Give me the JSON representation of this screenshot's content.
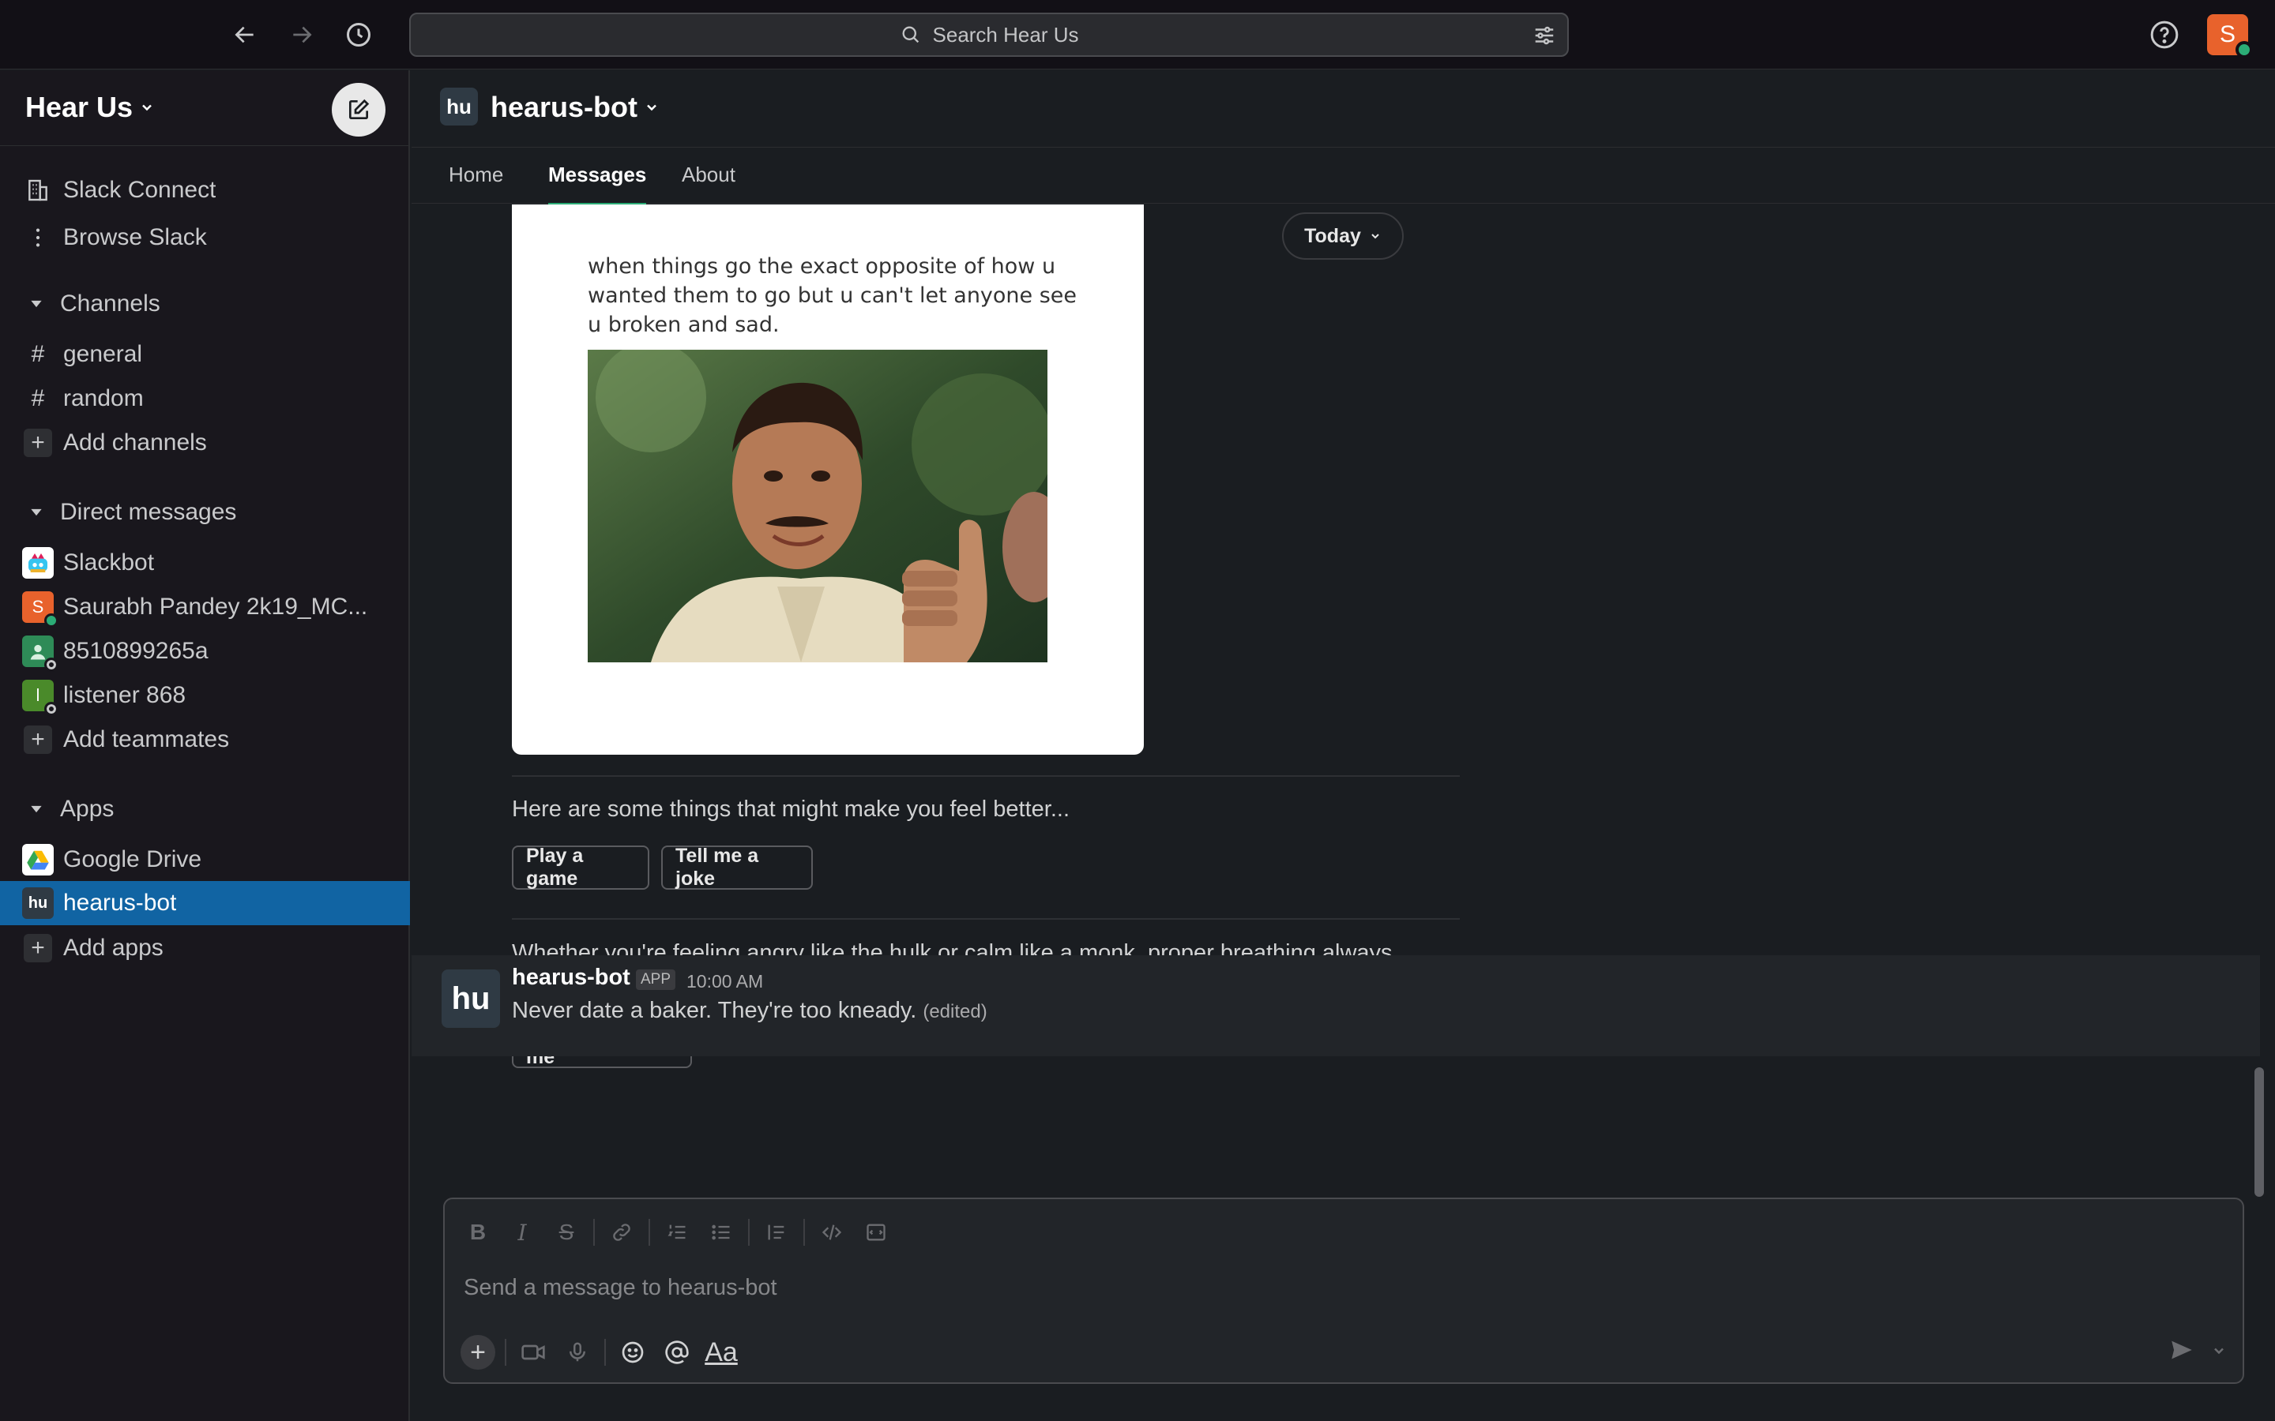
{
  "topbar": {
    "search_placeholder": "Search Hear Us",
    "user_initial": "S"
  },
  "sidebar": {
    "workspace_name": "Hear Us",
    "top_items": [
      {
        "label": "Slack Connect"
      },
      {
        "label": "Browse Slack"
      }
    ],
    "channels_header": "Channels",
    "channels": [
      {
        "label": "general"
      },
      {
        "label": "random"
      }
    ],
    "add_channels": "Add channels",
    "dms_header": "Direct messages",
    "dms": [
      {
        "label": "Slackbot",
        "initial": ""
      },
      {
        "label": "Saurabh Pandey 2k19_MC...",
        "initial": "S",
        "color": "#e8622c"
      },
      {
        "label": "8510899265a",
        "initial": "",
        "color": "#2e8b57"
      },
      {
        "label": "listener 868",
        "initial": "l",
        "color": "#4a8a2a"
      }
    ],
    "add_teammates": "Add teammates",
    "apps_header": "Apps",
    "apps": [
      {
        "label": "Google Drive"
      },
      {
        "label": "hearus-bot",
        "initial": "hu"
      }
    ],
    "add_apps": "Add apps"
  },
  "channel": {
    "avatar": "hu",
    "name": "hearus-bot",
    "tabs": [
      {
        "label": "Home"
      },
      {
        "label": "Messages"
      },
      {
        "label": "About"
      }
    ]
  },
  "messages": {
    "date_divider": "Today",
    "meme_caption": "when things go the exact opposite of how u wanted them to go but u can't let anyone see u broken and sad.",
    "feel_better_text": "Here are some things that might make you feel better...",
    "buttons_row1": [
      "Play a game",
      "Tell me a joke"
    ],
    "breathing_text": "Whether you're feeling angry like the hulk or calm like a monk, proper breathing always brings a clarity in your thoughts.",
    "breathe_button": "Breathe with me",
    "last_message": {
      "avatar": "hu",
      "sender": "hearus-bot",
      "badge": "APP",
      "time": "10:00 AM",
      "text": "Never date a baker. They're too kneady.",
      "edited": "(edited)"
    }
  },
  "composer": {
    "placeholder": "Send a message to hearus-bot",
    "format_label": "Aa"
  },
  "colors": {
    "active_item": "#1164a3",
    "online": "#2bac76",
    "tab_underline": "#2bac76"
  }
}
